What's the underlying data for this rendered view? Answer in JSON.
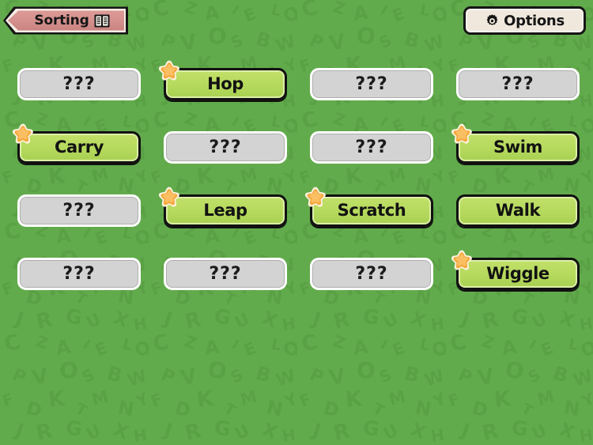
{
  "header": {
    "banner": {
      "label": "Sorting",
      "icon": "book-icon"
    },
    "options_button": {
      "label": "Options",
      "icon": "gear-icon"
    }
  },
  "theme": {
    "background_green": "#62ab4c",
    "banner_pink": "#d3908d",
    "options_cream": "#f0e8dd",
    "locked_gray": "#d3d3d3",
    "unlocked_green": "#b6da5e",
    "star_orange": "#f5a93f",
    "outline_black": "#111111"
  },
  "grid": {
    "columns": 4,
    "rows": 4,
    "locked_label": "???",
    "items": [
      {
        "label": "???",
        "state": "locked",
        "starred": false
      },
      {
        "label": "Hop",
        "state": "unlocked",
        "starred": true
      },
      {
        "label": "???",
        "state": "locked",
        "starred": false
      },
      {
        "label": "???",
        "state": "locked",
        "starred": false
      },
      {
        "label": "Carry",
        "state": "unlocked",
        "starred": true
      },
      {
        "label": "???",
        "state": "locked",
        "starred": false
      },
      {
        "label": "???",
        "state": "locked",
        "starred": false
      },
      {
        "label": "Swim",
        "state": "unlocked",
        "starred": true
      },
      {
        "label": "???",
        "state": "locked",
        "starred": false
      },
      {
        "label": "Leap",
        "state": "unlocked",
        "starred": true
      },
      {
        "label": "Scratch",
        "state": "unlocked",
        "starred": true
      },
      {
        "label": "Walk",
        "state": "unlocked",
        "starred": false
      },
      {
        "label": "???",
        "state": "locked",
        "starred": false
      },
      {
        "label": "???",
        "state": "locked",
        "starred": false
      },
      {
        "label": "???",
        "state": "locked",
        "starred": false
      },
      {
        "label": "Wiggle",
        "state": "unlocked",
        "starred": true
      }
    ]
  },
  "background": {
    "pattern_letters": [
      "C",
      "Z",
      "A",
      "I",
      "E",
      "L",
      "Q",
      "P",
      "V",
      "O",
      "S",
      "B",
      "W",
      "F",
      "D",
      "K",
      "T",
      "M",
      "N",
      "Y",
      "J",
      "R",
      "G",
      "U",
      "X",
      "H"
    ]
  }
}
